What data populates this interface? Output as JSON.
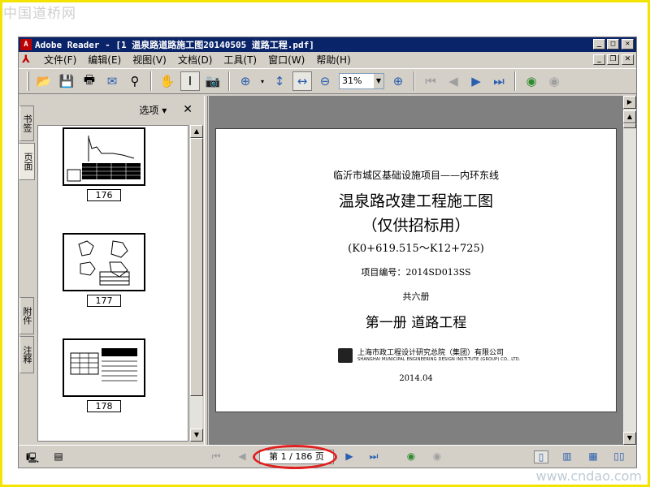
{
  "watermarks": {
    "top": "中国道桥网",
    "bottom": "www.cndao.com"
  },
  "window": {
    "title": "Adobe Reader - [1 温泉路道路施工图20140505 道路工程.pdf]"
  },
  "menu": [
    "文件(F)",
    "编辑(E)",
    "视图(V)",
    "文档(D)",
    "工具(T)",
    "窗口(W)",
    "帮助(H)"
  ],
  "toolbar": {
    "zoom": "31%"
  },
  "sidebar": {
    "tabs": [
      "书签",
      "页面",
      "附件",
      "注释"
    ],
    "options_label": "选项 ▾",
    "close_label": "✕",
    "thumbnails": [
      {
        "label": "176"
      },
      {
        "label": "177"
      },
      {
        "label": "178"
      }
    ]
  },
  "document": {
    "line1": "临沂市城区基础设施项目——内环东线",
    "line2": "温泉路改建工程施工图",
    "line3": "（仅供招标用）",
    "line4": "(K0+619.515～K12+725)",
    "line5": "项目编号：2014SD013SS",
    "line6": "共六册",
    "line7": "第一册    道路工程",
    "org_cn": "上海市政工程设计研究总院（集团）有限公司",
    "org_en": "SHANGHAI MUNICIPAL ENGINEERING DESIGN INSTITUTE (GROUP) CO., LTD.",
    "date": "2014.04"
  },
  "status": {
    "page_field": "第 1 / 186 页"
  },
  "colors": {
    "titlebar": "#0a246a",
    "frame": "#f2e400",
    "highlight_ring": "#e02020"
  }
}
